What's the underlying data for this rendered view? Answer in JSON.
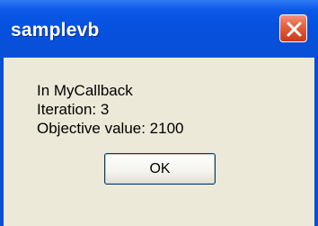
{
  "window": {
    "title": "samplevb",
    "close_icon": "close-icon"
  },
  "message": {
    "line1": "In MyCallback",
    "line2": "Iteration:  3",
    "line3": "Objective value:  2100"
  },
  "buttons": {
    "ok_label": "OK"
  },
  "colors": {
    "titlebar": "#0a4fd6",
    "close_button": "#e35f3c",
    "client_bg": "#ece9d8"
  }
}
